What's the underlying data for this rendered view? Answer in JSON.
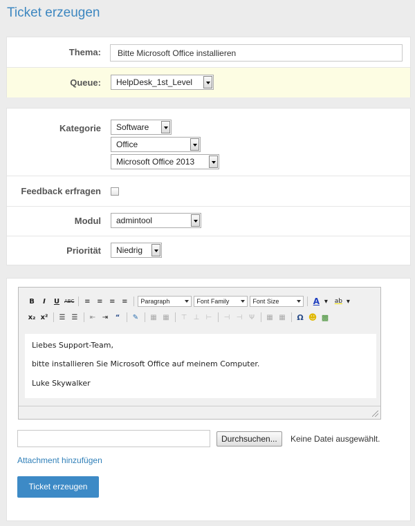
{
  "page": {
    "title": "Ticket erzeugen"
  },
  "form1": {
    "subject_label": "Thema:",
    "subject_value": "Bitte Microsoft Office installieren",
    "queue_label": "Queue:",
    "queue_value": "HelpDesk_1st_Level"
  },
  "form2": {
    "category_label": "Kategorie",
    "category_1": "Software",
    "category_2": "Office",
    "category_3": "Microsoft Office 2013",
    "feedback_label": "Feedback erfragen",
    "feedback_checked": false,
    "module_label": "Modul",
    "module_value": "admintool",
    "priority_label": "Priorität",
    "priority_value": "Niedrig"
  },
  "editor": {
    "toolbar": {
      "bold": "B",
      "italic": "I",
      "underline": "U",
      "strike": "ABC",
      "format_select": "Paragraph",
      "font_family_select": "Font Family",
      "font_size_select": "Font Size",
      "text_color_icon": "A",
      "highlight_icon": "ab",
      "subscript": "x₂",
      "superscript": "x²",
      "special_char": "Ω",
      "text_color": "#1f3fbf",
      "highlight_color": "#f2e200"
    },
    "body_lines": [
      "Liebes Support-Team,",
      "bitte installieren Sie Microsoft Office auf meinem Computer.",
      "Luke Skywalker"
    ]
  },
  "upload": {
    "file_value": "",
    "browse_label": "Durchsuchen...",
    "no_file_text": "Keine Datei ausgewählt.",
    "add_attachment": "Attachment hinzufügen"
  },
  "submit_label": "Ticket erzeugen",
  "colors": {
    "accent": "#3d8ac6",
    "title": "#3d87c0",
    "highlight_row": "#fdfde3"
  }
}
